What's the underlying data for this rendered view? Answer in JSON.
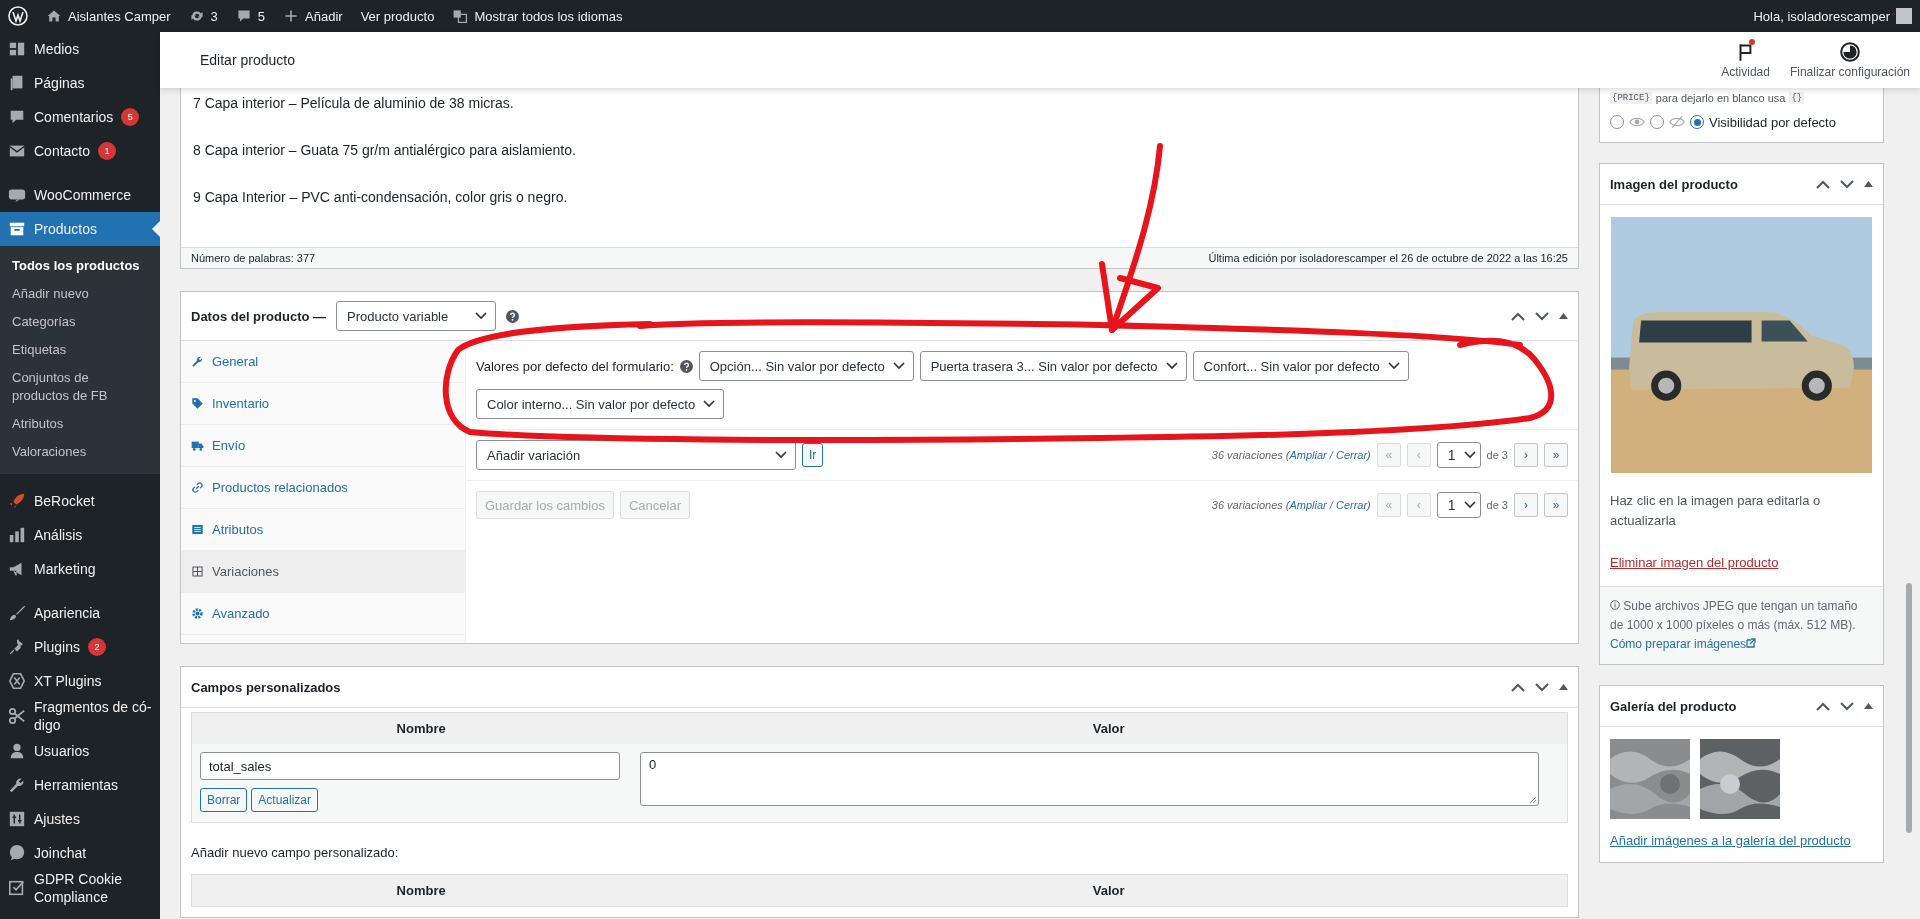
{
  "admin_bar": {
    "items": [
      {
        "kind": "logo"
      },
      {
        "kind": "icon_link",
        "label": "Aislantes Camper"
      },
      {
        "kind": "icon_link",
        "label": "3"
      },
      {
        "kind": "icon_link",
        "label": "5"
      },
      {
        "kind": "icon_link",
        "label": "Añadir"
      },
      {
        "kind": "link",
        "label": "Ver producto"
      },
      {
        "kind": "icon_link",
        "label": "Mostrar todos los idiomas"
      }
    ],
    "greeting": "Hola, isoladorescamper"
  },
  "sidebar": {
    "items": [
      {
        "label": "Medios",
        "selected": false
      },
      {
        "label": "Páginas",
        "selected": false
      },
      {
        "label": "Comentarios",
        "badge": "5",
        "selected": false
      },
      {
        "label": "Contacto",
        "badge": "1",
        "selected": false
      },
      {
        "label": "WooCommerce",
        "selected": false
      },
      {
        "label": "Productos",
        "selected": true,
        "children": [
          {
            "label": "Todos los productos",
            "selected": true
          },
          {
            "label": "Añadir nuevo",
            "selected": false
          },
          {
            "label": "Categorías",
            "selected": false
          },
          {
            "label": "Etiquetas",
            "selected": false
          },
          {
            "label": "Conjuntos de productos de FB",
            "selected": false
          },
          {
            "label": "Atributos",
            "selected": false
          },
          {
            "label": "Valoraciones",
            "selected": false
          }
        ]
      },
      {
        "label": "BeRocket",
        "selected": false
      },
      {
        "label": "Análisis",
        "selected": false
      },
      {
        "label": "Marketing",
        "selected": false
      },
      {
        "label": "Apariencia",
        "selected": false
      },
      {
        "label": "Plugins",
        "badge": "2",
        "selected": false
      },
      {
        "label": "XT Plugins",
        "selected": false
      },
      {
        "label": "Fragmentos de có-digo",
        "selected": false
      },
      {
        "label": "Usuarios",
        "selected": false
      },
      {
        "label": "Herramientas",
        "selected": false
      },
      {
        "label": "Ajustes",
        "selected": false
      },
      {
        "label": "Joinchat",
        "selected": false
      },
      {
        "label": "GDPR Cookie Compliance",
        "selected": false
      }
    ]
  },
  "header": {
    "title": "Editar producto",
    "actions": [
      {
        "label": "Actividad",
        "notification": true
      },
      {
        "label": "Finalizar configuración",
        "notification": false
      }
    ]
  },
  "editor": {
    "paragraphs": [
      "7 Capa interior – Película de aluminio de 38 micras.",
      "8 Capa interior – Guata 75 gr/m antialérgico para aislamiento.",
      "9 Capa Interior – PVC  anti-condensación, color gris o negro."
    ],
    "word_count": "Número de palabras: 377",
    "last_edit": "Última edición por isoladorescamper el 26 de octubre de 2022 a las 16:25"
  },
  "product_data": {
    "title": "Datos del producto —",
    "type_select": "Producto variable",
    "tabs": [
      {
        "label": "General",
        "selected": false
      },
      {
        "label": "Inventario",
        "selected": false
      },
      {
        "label": "Envío",
        "selected": false
      },
      {
        "label": "Productos relacionados",
        "selected": false
      },
      {
        "label": "Atributos",
        "selected": false
      },
      {
        "label": "Variaciones",
        "selected": true
      },
      {
        "label": "Avanzado",
        "selected": false
      }
    ],
    "defaults_label": "Valores por defecto del formulario:",
    "defaults": [
      "Opción... Sin valor por defecto",
      "Puerta trasera 3... Sin valor por defecto",
      "Confort... Sin valor por defecto",
      "Color interno... Sin valor por defecto"
    ],
    "add_variation": "Añadir variación",
    "go_button": "Ir",
    "buttons": [
      {
        "label": "Guardar los cambios",
        "disabled": true
      },
      {
        "label": "Cancelar",
        "disabled": true
      }
    ],
    "paginations": [
      {
        "summary": [
          {
            "kind": "text",
            "text": "36 variaciones ("
          },
          {
            "kind": "link",
            "text": "Ampliar"
          },
          {
            "kind": "text",
            "text": " / "
          },
          {
            "kind": "link",
            "text": "Cerrar"
          },
          {
            "kind": "text",
            "text": ")"
          }
        ],
        "nav_before": [
          {
            "label": "«",
            "disabled": true
          },
          {
            "label": "‹",
            "disabled": true
          }
        ],
        "page": "1",
        "of": "de 3",
        "nav_after": [
          {
            "label": "›",
            "disabled": false
          },
          {
            "label": "»",
            "disabled": false
          }
        ]
      },
      {
        "summary": [
          {
            "kind": "text",
            "text": "36 variaciones ("
          },
          {
            "kind": "link",
            "text": "Ampliar"
          },
          {
            "kind": "text",
            "text": " / "
          },
          {
            "kind": "link",
            "text": "Cerrar"
          },
          {
            "kind": "text",
            "text": ")"
          }
        ],
        "nav_before": [
          {
            "label": "«",
            "disabled": true
          },
          {
            "label": "‹",
            "disabled": true
          }
        ],
        "page": "1",
        "of": "de 3",
        "nav_after": [
          {
            "label": "›",
            "disabled": false
          },
          {
            "label": "»",
            "disabled": false
          }
        ]
      }
    ]
  },
  "custom_fields": {
    "title": "Campos personalizados",
    "columns": [
      "Nombre",
      "Valor"
    ],
    "rows": [
      {
        "name": "total_sales",
        "value": "0",
        "buttons": [
          "Borrar",
          "Actualizar"
        ]
      }
    ],
    "add_label": "Añadir nuevo campo personalizado:",
    "add_columns": [
      "Nombre",
      "Valor"
    ]
  },
  "visibility": {
    "note": [
      {
        "kind": "code",
        "text": "{PRICE}"
      },
      {
        "kind": "text",
        "text": "para dejarlo en blanco usa"
      },
      {
        "kind": "code",
        "text": "{}"
      }
    ],
    "options": [
      {
        "kind": "icon",
        "selected": false
      },
      {
        "kind": "icon",
        "selected": false
      },
      {
        "kind": "label",
        "label": "Visibilidad por defecto",
        "selected": true
      }
    ]
  },
  "image_box": {
    "title": "Imagen del producto",
    "hint": "Haz clic en la imagen para editarla o actualizarla",
    "remove": "Eliminar imagen del producto",
    "info": "Sube archivos JPEG que tengan un tamaño de 1000 x 1000 píxeles o más (máx. 512 MB).",
    "info_link": "Cómo preparar imágenes"
  },
  "gallery": {
    "title": "Galería del producto",
    "add": "Añadir imágenes a la galería del producto"
  }
}
